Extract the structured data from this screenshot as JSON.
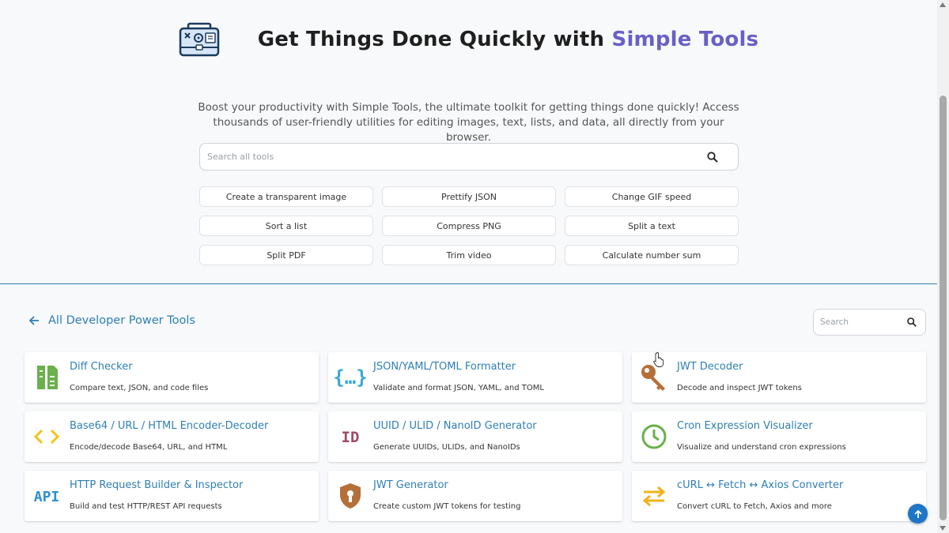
{
  "hero": {
    "title_main": "Get Things Done Quickly with ",
    "title_accent": "Simple Tools",
    "description": "Boost your productivity with Simple Tools, the ultimate toolkit for getting things done quickly! Access thousands of user-friendly utilities for editing images, text, lists, and data, all directly from your browser.",
    "logo_icon": "toolbox-icon"
  },
  "search": {
    "placeholder": "Search all tools",
    "icon": "search-icon"
  },
  "quick_links": [
    "Create a transparent image",
    "Prettify JSON",
    "Change GIF speed",
    "Sort a list",
    "Compress PNG",
    "Split a text",
    "Split PDF",
    "Trim video",
    "Calculate number sum"
  ],
  "section": {
    "title": "All Developer Power Tools",
    "back_icon": "arrow-left-icon",
    "search_placeholder": "Search"
  },
  "tools": [
    {
      "name": "Diff Checker",
      "desc": "Compare text, JSON, and code files",
      "icon": "diff-icon",
      "color": "#6ab04c"
    },
    {
      "name": "JSON/YAML/TOML Formatter",
      "desc": "Validate and format JSON, YAML, and TOML",
      "icon": "curly-braces-icon",
      "color": "#3aa8d8"
    },
    {
      "name": "JWT Decoder",
      "desc": "Decode and inspect JWT tokens",
      "icon": "key-icon",
      "color": "#b5703a"
    },
    {
      "name": "Base64 / URL / HTML Encoder-Decoder",
      "desc": "Encode/decode Base64, URL, and HTML",
      "icon": "code-brackets-icon",
      "color": "#f2c31a"
    },
    {
      "name": "UUID / ULID / NanoID Generator",
      "desc": "Generate UUIDs, ULIDs, and NanoIDs",
      "icon": "id-icon",
      "color": "#a04a6a"
    },
    {
      "name": "Cron Expression Visualizer",
      "desc": "Visualize and understand cron expressions",
      "icon": "clock-icon",
      "color": "#6ab04c"
    },
    {
      "name": "HTTP Request Builder & Inspector",
      "desc": "Build and test HTTP/REST API requests",
      "icon": "api-icon",
      "color": "#2f8fd0"
    },
    {
      "name": "JWT Generator",
      "desc": "Create custom JWT tokens for testing",
      "icon": "shield-keyhole-icon",
      "color": "#b5703a"
    },
    {
      "name": "cURL ↔ Fetch ↔ Axios Converter",
      "desc": "Convert cURL to Fetch, Axios and more",
      "icon": "swap-arrows-icon",
      "color": "#f2b21a"
    }
  ],
  "colors": {
    "accent": "#6a5fc8",
    "link": "#2f7fb5",
    "to_top": "#1f76c7"
  }
}
